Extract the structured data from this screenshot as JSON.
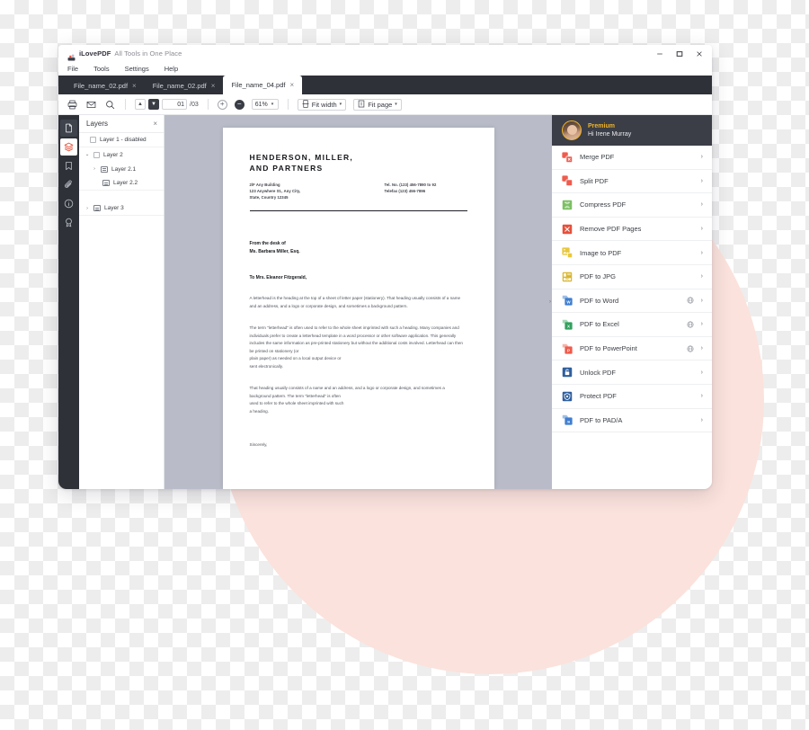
{
  "app": {
    "brand_name": "iLovePDF",
    "brand_tagline": "All Tools in One Place",
    "brand_icon": "ilovepdf-logo-icon",
    "window_controls": [
      {
        "name": "minimize-button",
        "glyph": "–"
      },
      {
        "name": "maximize-button",
        "glyph": "❐"
      },
      {
        "name": "close-button",
        "glyph": "✕"
      }
    ]
  },
  "menubar": {
    "items": [
      {
        "label": "File"
      },
      {
        "label": "Tools"
      },
      {
        "label": "Settings"
      },
      {
        "label": "Help"
      }
    ]
  },
  "tabs": [
    {
      "label": "File_name_02.pdf",
      "close": "×",
      "active": false
    },
    {
      "label": "File_name_02.pdf",
      "close": "×",
      "active": false
    },
    {
      "label": "File_name_04.pdf",
      "close": "×",
      "active": true
    }
  ],
  "toolbar": {
    "print_icon": "print-icon",
    "email_icon": "envelope-icon",
    "search_icon": "search-icon",
    "prev_page_glyph": "▲",
    "next_page_glyph": "▼",
    "page_current": "01",
    "page_total": "/03",
    "zoom_in_glyph": "+",
    "zoom_out_glyph": "−",
    "zoom_level": "61%",
    "zoom_caret": "▾",
    "fit_width_label": "Fit width",
    "fit_width_icon": "fit-width-icon",
    "fit_page_label": "Fit page",
    "fit_page_icon": "fit-page-icon",
    "caret": "▾"
  },
  "rail": {
    "items": [
      {
        "name": "pages-icon",
        "state": "selected"
      },
      {
        "name": "layers-icon",
        "state": "active"
      },
      {
        "name": "bookmark-icon",
        "state": "normal"
      },
      {
        "name": "attachment-icon",
        "state": "normal"
      },
      {
        "name": "info-icon",
        "state": "normal"
      },
      {
        "name": "signature-icon",
        "state": "normal"
      }
    ]
  },
  "layers_panel": {
    "title": "Layers",
    "close_glyph": "×",
    "rows": [
      {
        "label": "Layer 1 - disabled",
        "indent": 0,
        "chevron": "",
        "checkbox": true,
        "icon": false
      },
      {
        "label": "Layer 2",
        "indent": 0,
        "chevron": "⌄",
        "checkbox": true,
        "icon": false
      },
      {
        "label": "Layer 2.1",
        "indent": 1,
        "chevron": "›",
        "checkbox": false,
        "icon": true
      },
      {
        "label": "Layer 2.2",
        "indent": 2,
        "chevron": "",
        "checkbox": false,
        "icon": true
      },
      {
        "label": "Layer 3",
        "indent": 0,
        "chevron": "›",
        "checkbox": false,
        "icon": true
      }
    ]
  },
  "document": {
    "title_line1": "HENDERSON, MILLER,",
    "title_line2": "AND PARTNERS",
    "address_line1": "2/F Any Building",
    "address_line2": "123 Anywhere St., Any City,",
    "address_line3": "State, Country 12345",
    "tel_line1": "Tel. No. (123) 456-7890 to 92",
    "tel_line2": "Telefax (123) 456-7896",
    "from_line1": "From the desk of",
    "from_line2": "Ms. Barbara Miller, Esq.",
    "salutation": "To Mrs. Eleanor Fitzgerald,",
    "paragraph1": "A letterhead is the heading at the top of a sheet of letter paper (stationery). That heading usually consists of a name and an address, and a logo or corporate design, and sometimes a background pattern.",
    "paragraph2": "The term \"letterhead\" is often used to refer to the whole sheet imprinted with such a heading. Many companies and individuals prefer to create a letterhead template in a word processor or other software application. This generally includes the same information as pre-printed stationery but without the additional costs involved. Letterhead can then be printed on stationery (or\nplain paper) as needed on a local output device or\nsent electronically.",
    "paragraph3": "That heading usually consists of a name and an address, and a logo or corporate design, and sometimes a background pattern. The term \"letterhead\" is often\nused to refer to the whole sheet imprinted with such\na heading.",
    "closing": "Sincerely,",
    "collapse_handle_glyph": "›"
  },
  "account": {
    "plan": "Premium",
    "greeting": "Hi Irene Murray",
    "avatar": "user-avatar"
  },
  "tools": [
    {
      "label": "Merge PDF",
      "icon": "merge-pdf-icon",
      "color": "#ef5b4c",
      "globe": false,
      "arrow": "›"
    },
    {
      "label": "Split PDF",
      "icon": "split-pdf-icon",
      "color": "#ef5b4c",
      "globe": false,
      "arrow": "›"
    },
    {
      "label": "Compress PDF",
      "icon": "compress-pdf-icon",
      "color": "#7cc063",
      "globe": false,
      "arrow": "›"
    },
    {
      "label": "Remove PDF Pages",
      "icon": "remove-pdf-pages-icon",
      "color": "#e8503a",
      "globe": false,
      "arrow": "›"
    },
    {
      "label": "Image to PDF",
      "icon": "image-to-pdf-icon",
      "color": "#e8c83c",
      "globe": false,
      "arrow": "›"
    },
    {
      "label": "PDF to JPG",
      "icon": "pdf-to-jpg-icon",
      "color": "#d9b62e",
      "globe": false,
      "arrow": "›"
    },
    {
      "label": "PDF to Word",
      "icon": "pdf-to-word-icon",
      "color": "#3f7ed0",
      "globe": true,
      "arrow": "›"
    },
    {
      "label": "PDF to Excel",
      "icon": "pdf-to-excel-icon",
      "color": "#33a05d",
      "globe": true,
      "arrow": "›"
    },
    {
      "label": "PDF to PowerPoint",
      "icon": "pdf-to-powerpoint-icon",
      "color": "#ef5b4c",
      "globe": true,
      "arrow": "›"
    },
    {
      "label": "Unlock PDF",
      "icon": "unlock-pdf-icon",
      "color": "#2f5f9e",
      "globe": false,
      "arrow": "›"
    },
    {
      "label": "Protect PDF",
      "icon": "protect-pdf-icon",
      "color": "#2f5f9e",
      "globe": false,
      "arrow": "›"
    },
    {
      "label": "PDF to PAD/A",
      "icon": "pdf-to-pdfa-icon",
      "color": "#3f7ed0",
      "globe": false,
      "arrow": "›"
    }
  ],
  "theme": {
    "accent_pink": "#FBE2DC",
    "dark_chrome": "#2e3138",
    "panel_dark": "#3b3e46",
    "premium_gold": "#f0b429",
    "viewer_bg": "#b9bcc8"
  }
}
